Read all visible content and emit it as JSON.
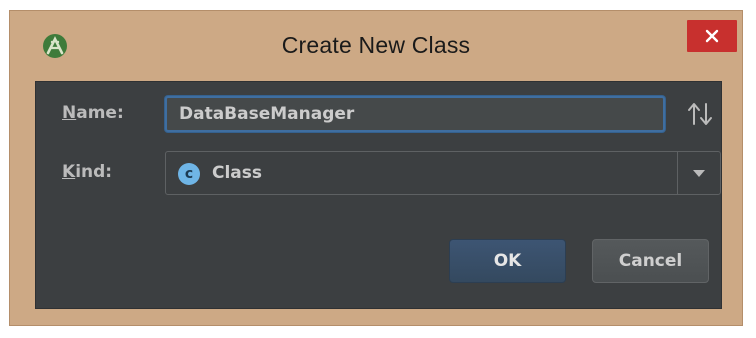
{
  "window": {
    "title": "Create New Class",
    "app_icon": "android-studio-icon",
    "close_icon": "close-icon"
  },
  "form": {
    "name_label_mnemonic": "N",
    "name_label_rest": "ame:",
    "name_value": "DataBaseManager",
    "sort_icon": "sort-arrows-icon",
    "kind_label_mnemonic": "K",
    "kind_label_rest": "ind:",
    "kind_icon_letter": "c",
    "kind_value": "Class",
    "kind_dropdown_icon": "chevron-down-icon"
  },
  "buttons": {
    "ok_label": "OK",
    "cancel_label": "Cancel"
  },
  "colors": {
    "window_frame": "#cda985",
    "content_bg": "#3c3f41",
    "close_button": "#c8302e",
    "focus_border": "#3f6ea0",
    "class_icon": "#6fb5e6"
  }
}
